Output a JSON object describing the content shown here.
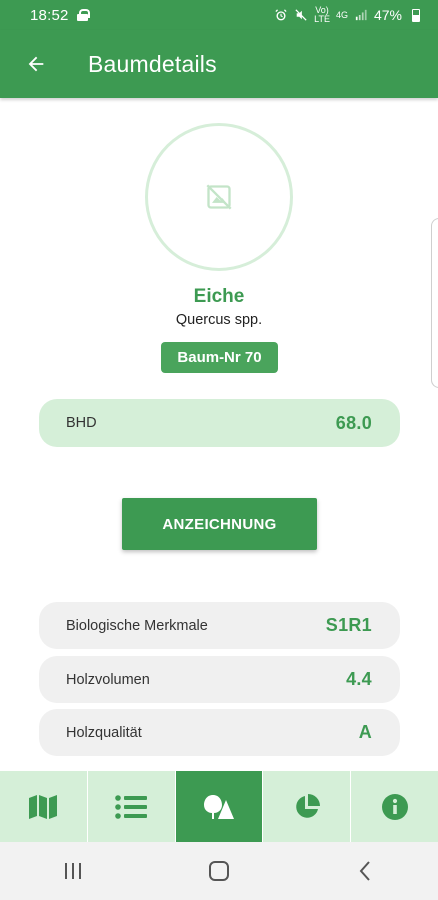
{
  "status_bar": {
    "time": "18:52",
    "network_top": "Vo)",
    "network_bottom": "LTE",
    "network_type": "4G",
    "battery": "47%"
  },
  "app_bar": {
    "title": "Baumdetails",
    "back_icon": "arrow-left-icon"
  },
  "tree": {
    "image_placeholder_icon": "image-off-icon",
    "name": "Eiche",
    "latin_name": "Quercus spp.",
    "number_badge": "Baum-Nr 70"
  },
  "bhd": {
    "label": "BHD",
    "value": "68.0"
  },
  "marking_button": {
    "label": "ANZEICHNUNG"
  },
  "details": [
    {
      "label": "Biologische Merkmale",
      "value": "S1R1"
    },
    {
      "label": "Holzvolumen",
      "value": "4.4"
    },
    {
      "label": "Holzqualität",
      "value": "A"
    }
  ],
  "bottom_nav": {
    "active_index": 2,
    "items": [
      {
        "icon": "map-icon"
      },
      {
        "icon": "list-icon"
      },
      {
        "icon": "tree-shapes-icon"
      },
      {
        "icon": "pie-chart-icon"
      },
      {
        "icon": "info-icon"
      }
    ]
  },
  "system_nav": {
    "items": [
      "recent-apps-icon",
      "home-icon",
      "back-chevron-icon"
    ]
  },
  "colors": {
    "primary": "#3d9a52",
    "light_green": "#d5efd8",
    "row_gray": "#f0f0f0"
  }
}
